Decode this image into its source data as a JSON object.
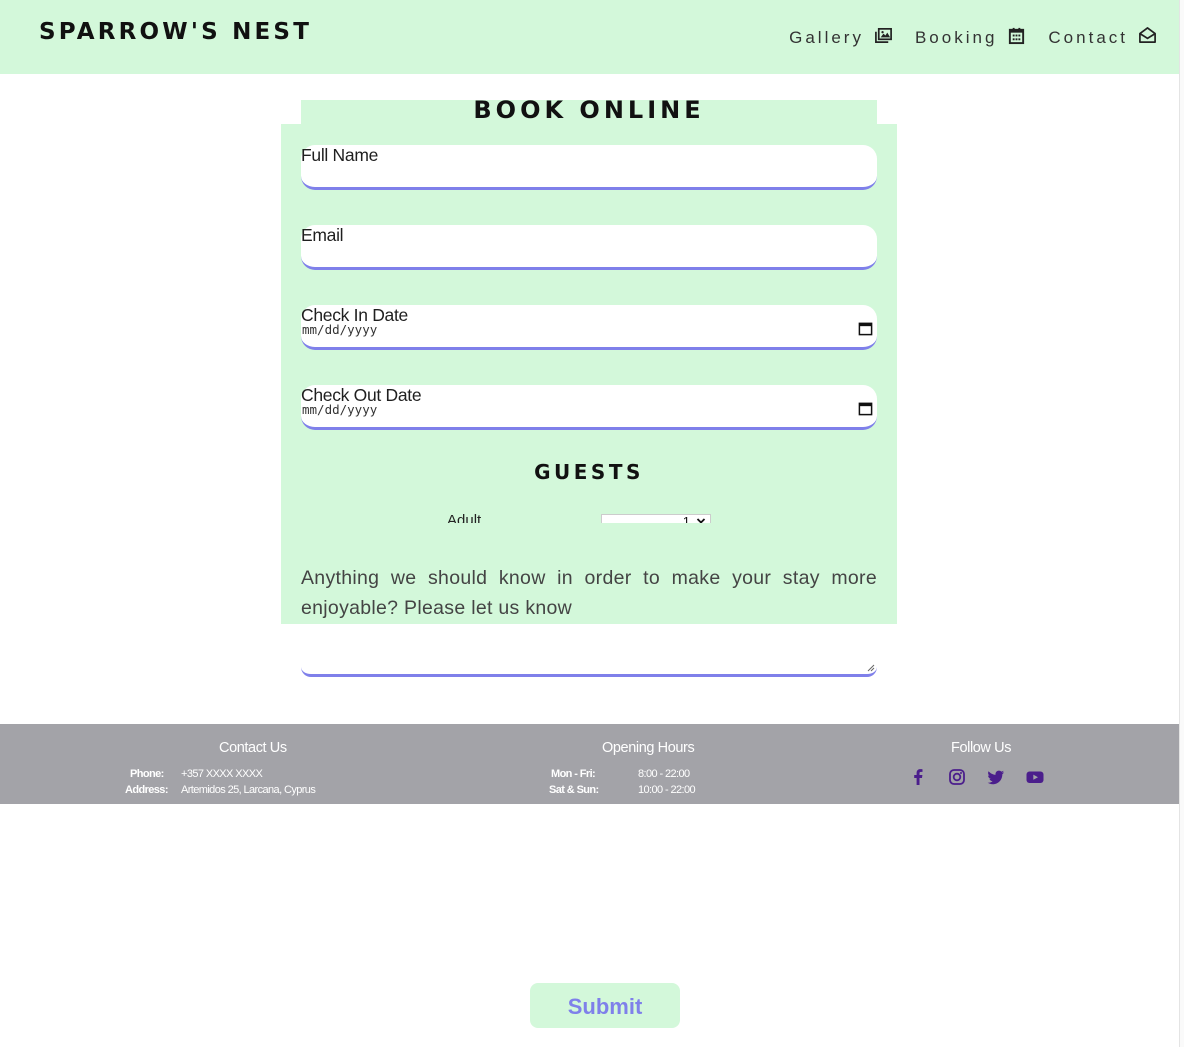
{
  "header": {
    "brand": "SPARROW'S NEST",
    "nav": [
      {
        "label": "Gallery",
        "icon": "gallery-icon"
      },
      {
        "label": "Booking",
        "icon": "calendar-icon"
      },
      {
        "label": "Contact",
        "icon": "envelope-icon"
      }
    ]
  },
  "form": {
    "title": "BOOK ONLINE",
    "fields": {
      "full_name": {
        "label": "Full Name",
        "value": ""
      },
      "email": {
        "label": "Email",
        "value": ""
      },
      "check_in": {
        "label": "Check In Date",
        "placeholder": "mm/dd/yyyy"
      },
      "check_out": {
        "label": "Check Out Date",
        "placeholder": "mm/dd/yyyy"
      }
    },
    "guests_title": "GUESTS",
    "adult_label": "Adult",
    "adult_value": "1",
    "message_label": "Anything we should know in order to make your stay more enjoyable? Please let us know",
    "message_value": "",
    "submit_label": "Submit"
  },
  "footer": {
    "contact": {
      "title": "Contact Us",
      "phone_label": "Phone:",
      "phone_value": "+357 XXXX XXXX",
      "address_label": "Address:",
      "address_value": "Artemidos 25, Larcana, Cyprus"
    },
    "hours": {
      "title": "Opening Hours",
      "weekday_label": "Mon - Fri:",
      "weekday_value": "8:00 - 22:00",
      "weekend_label": "Sat & Sun:",
      "weekend_value": "10:00 - 22:00"
    },
    "follow": {
      "title": "Follow Us",
      "icons": [
        "facebook-icon",
        "instagram-icon",
        "twitter-icon",
        "youtube-icon"
      ]
    }
  },
  "colors": {
    "mint": "#d3f8da",
    "accent": "#7f80ea",
    "footer_bg": "#a3a3a8",
    "social": "#4b1e8c"
  }
}
